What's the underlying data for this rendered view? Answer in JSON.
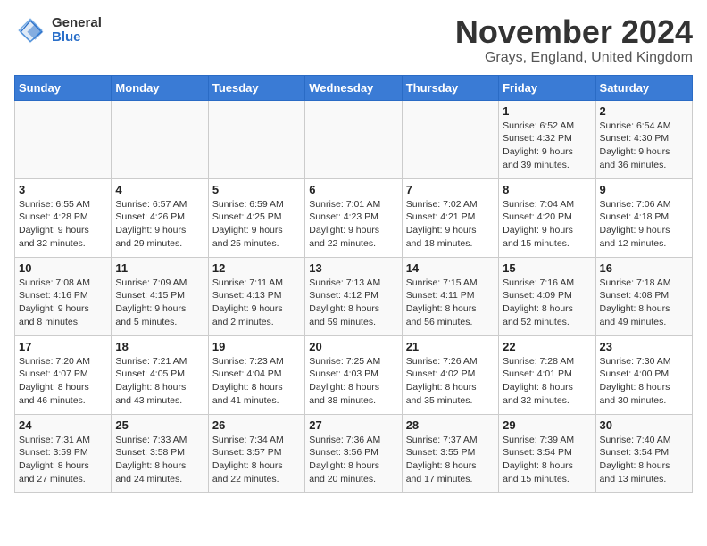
{
  "logo": {
    "general": "General",
    "blue": "Blue"
  },
  "title": "November 2024",
  "location": "Grays, England, United Kingdom",
  "days_of_week": [
    "Sunday",
    "Monday",
    "Tuesday",
    "Wednesday",
    "Thursday",
    "Friday",
    "Saturday"
  ],
  "weeks": [
    [
      {
        "day": "",
        "info": ""
      },
      {
        "day": "",
        "info": ""
      },
      {
        "day": "",
        "info": ""
      },
      {
        "day": "",
        "info": ""
      },
      {
        "day": "",
        "info": ""
      },
      {
        "day": "1",
        "info": "Sunrise: 6:52 AM\nSunset: 4:32 PM\nDaylight: 9 hours\nand 39 minutes."
      },
      {
        "day": "2",
        "info": "Sunrise: 6:54 AM\nSunset: 4:30 PM\nDaylight: 9 hours\nand 36 minutes."
      }
    ],
    [
      {
        "day": "3",
        "info": "Sunrise: 6:55 AM\nSunset: 4:28 PM\nDaylight: 9 hours\nand 32 minutes."
      },
      {
        "day": "4",
        "info": "Sunrise: 6:57 AM\nSunset: 4:26 PM\nDaylight: 9 hours\nand 29 minutes."
      },
      {
        "day": "5",
        "info": "Sunrise: 6:59 AM\nSunset: 4:25 PM\nDaylight: 9 hours\nand 25 minutes."
      },
      {
        "day": "6",
        "info": "Sunrise: 7:01 AM\nSunset: 4:23 PM\nDaylight: 9 hours\nand 22 minutes."
      },
      {
        "day": "7",
        "info": "Sunrise: 7:02 AM\nSunset: 4:21 PM\nDaylight: 9 hours\nand 18 minutes."
      },
      {
        "day": "8",
        "info": "Sunrise: 7:04 AM\nSunset: 4:20 PM\nDaylight: 9 hours\nand 15 minutes."
      },
      {
        "day": "9",
        "info": "Sunrise: 7:06 AM\nSunset: 4:18 PM\nDaylight: 9 hours\nand 12 minutes."
      }
    ],
    [
      {
        "day": "10",
        "info": "Sunrise: 7:08 AM\nSunset: 4:16 PM\nDaylight: 9 hours\nand 8 minutes."
      },
      {
        "day": "11",
        "info": "Sunrise: 7:09 AM\nSunset: 4:15 PM\nDaylight: 9 hours\nand 5 minutes."
      },
      {
        "day": "12",
        "info": "Sunrise: 7:11 AM\nSunset: 4:13 PM\nDaylight: 9 hours\nand 2 minutes."
      },
      {
        "day": "13",
        "info": "Sunrise: 7:13 AM\nSunset: 4:12 PM\nDaylight: 8 hours\nand 59 minutes."
      },
      {
        "day": "14",
        "info": "Sunrise: 7:15 AM\nSunset: 4:11 PM\nDaylight: 8 hours\nand 56 minutes."
      },
      {
        "day": "15",
        "info": "Sunrise: 7:16 AM\nSunset: 4:09 PM\nDaylight: 8 hours\nand 52 minutes."
      },
      {
        "day": "16",
        "info": "Sunrise: 7:18 AM\nSunset: 4:08 PM\nDaylight: 8 hours\nand 49 minutes."
      }
    ],
    [
      {
        "day": "17",
        "info": "Sunrise: 7:20 AM\nSunset: 4:07 PM\nDaylight: 8 hours\nand 46 minutes."
      },
      {
        "day": "18",
        "info": "Sunrise: 7:21 AM\nSunset: 4:05 PM\nDaylight: 8 hours\nand 43 minutes."
      },
      {
        "day": "19",
        "info": "Sunrise: 7:23 AM\nSunset: 4:04 PM\nDaylight: 8 hours\nand 41 minutes."
      },
      {
        "day": "20",
        "info": "Sunrise: 7:25 AM\nSunset: 4:03 PM\nDaylight: 8 hours\nand 38 minutes."
      },
      {
        "day": "21",
        "info": "Sunrise: 7:26 AM\nSunset: 4:02 PM\nDaylight: 8 hours\nand 35 minutes."
      },
      {
        "day": "22",
        "info": "Sunrise: 7:28 AM\nSunset: 4:01 PM\nDaylight: 8 hours\nand 32 minutes."
      },
      {
        "day": "23",
        "info": "Sunrise: 7:30 AM\nSunset: 4:00 PM\nDaylight: 8 hours\nand 30 minutes."
      }
    ],
    [
      {
        "day": "24",
        "info": "Sunrise: 7:31 AM\nSunset: 3:59 PM\nDaylight: 8 hours\nand 27 minutes."
      },
      {
        "day": "25",
        "info": "Sunrise: 7:33 AM\nSunset: 3:58 PM\nDaylight: 8 hours\nand 24 minutes."
      },
      {
        "day": "26",
        "info": "Sunrise: 7:34 AM\nSunset: 3:57 PM\nDaylight: 8 hours\nand 22 minutes."
      },
      {
        "day": "27",
        "info": "Sunrise: 7:36 AM\nSunset: 3:56 PM\nDaylight: 8 hours\nand 20 minutes."
      },
      {
        "day": "28",
        "info": "Sunrise: 7:37 AM\nSunset: 3:55 PM\nDaylight: 8 hours\nand 17 minutes."
      },
      {
        "day": "29",
        "info": "Sunrise: 7:39 AM\nSunset: 3:54 PM\nDaylight: 8 hours\nand 15 minutes."
      },
      {
        "day": "30",
        "info": "Sunrise: 7:40 AM\nSunset: 3:54 PM\nDaylight: 8 hours\nand 13 minutes."
      }
    ]
  ]
}
